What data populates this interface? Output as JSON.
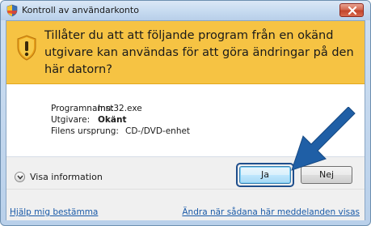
{
  "window": {
    "title": "Kontroll av användarkonto"
  },
  "banner": {
    "message": "Tillåter du att att följande program från en okänd utgivare kan användas för att göra ändringar på den här datorn?"
  },
  "details": {
    "program_label": "Programnamn:",
    "program_value": "Inst32.exe",
    "publisher_label": "Utgivare:",
    "publisher_value": "Okänt",
    "origin_label": "Filens ursprung:",
    "origin_value": "CD-/DVD-enhet"
  },
  "footer": {
    "show_info_label": "Visa information",
    "yes_label": "Ja",
    "no_label": "Nej"
  },
  "links": {
    "help_label": "Hjälp mig bestämma",
    "change_label": "Ändra när sådana här meddelanden visas"
  },
  "colors": {
    "banner": "#f6c343",
    "arrow": "#1f5fa6",
    "link": "#1a5aa8"
  },
  "icons": {
    "title": "shield-uac-icon",
    "banner": "shield-warning-icon",
    "close": "close-icon",
    "expand": "chevron-down-icon",
    "pointer": "arrow-pointer-icon"
  }
}
